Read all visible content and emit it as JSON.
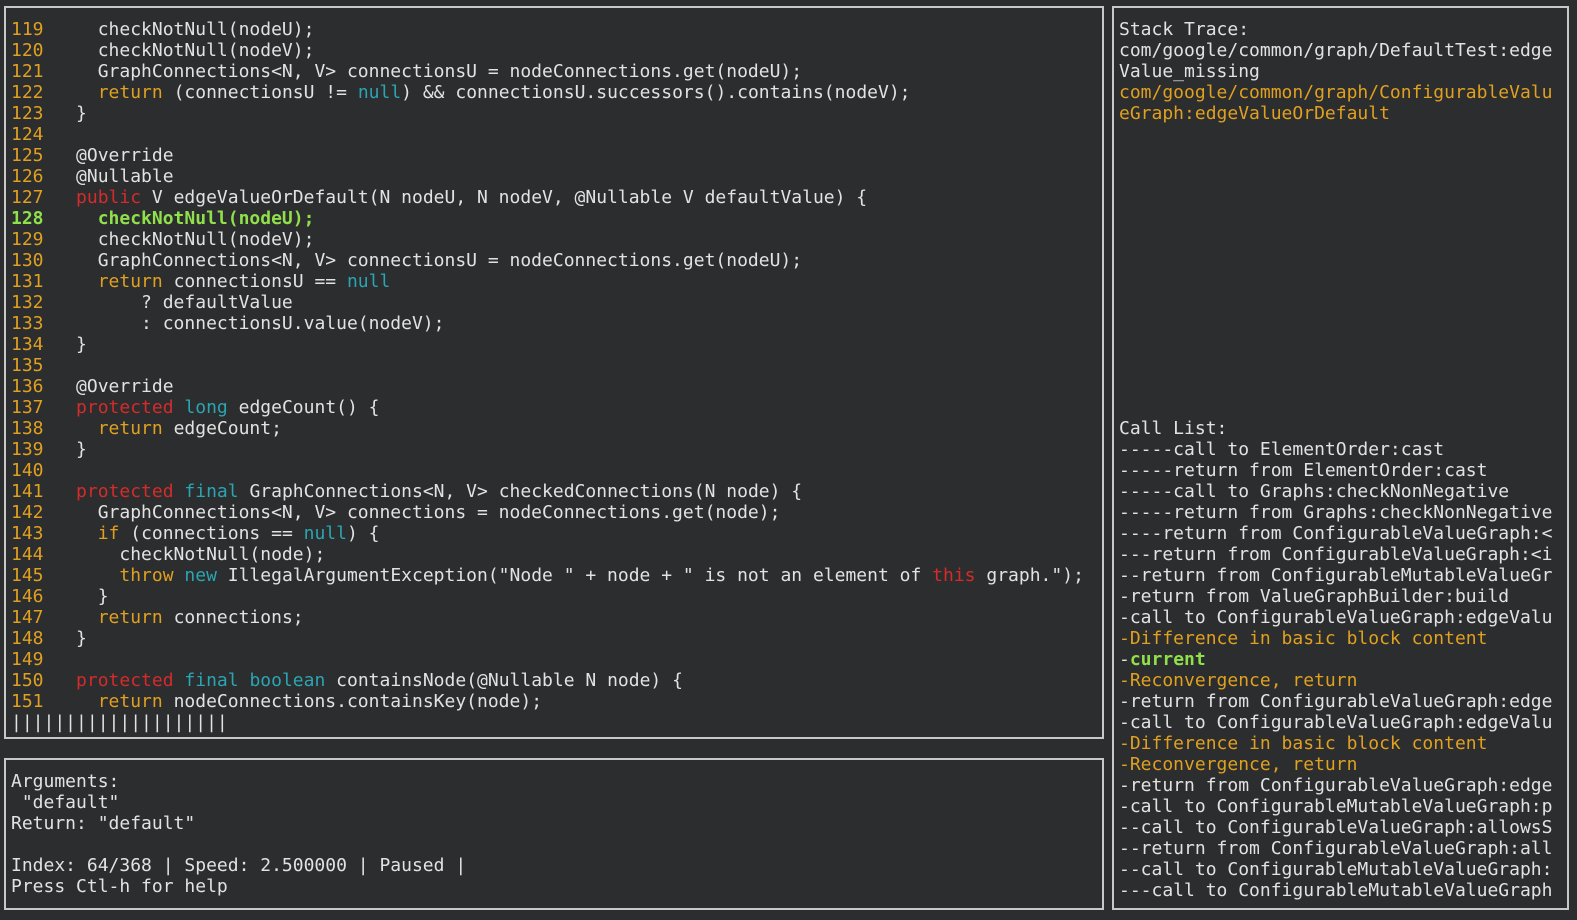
{
  "code": {
    "lines": [
      {
        "num": "119",
        "segments": [
          {
            "text": "    checkNotNull(nodeU);",
            "cls": "code-text"
          }
        ]
      },
      {
        "num": "120",
        "segments": [
          {
            "text": "    checkNotNull(nodeV);",
            "cls": "code-text"
          }
        ]
      },
      {
        "num": "121",
        "segments": [
          {
            "text": "    GraphConnections<N, V> connectionsU = nodeConnections.get(nodeU);",
            "cls": "code-text"
          }
        ]
      },
      {
        "num": "122",
        "segments": [
          {
            "text": "    ",
            "cls": "code-text"
          },
          {
            "text": "return",
            "cls": "kw-yellow"
          },
          {
            "text": " (connectionsU != ",
            "cls": "code-text"
          },
          {
            "text": "null",
            "cls": "kw-cyan"
          },
          {
            "text": ") && connectionsU.successors().contains(nodeV);",
            "cls": "code-text"
          }
        ]
      },
      {
        "num": "123",
        "segments": [
          {
            "text": "  }",
            "cls": "code-text"
          }
        ]
      },
      {
        "num": "124",
        "segments": []
      },
      {
        "num": "125",
        "segments": [
          {
            "text": "  @Override",
            "cls": "code-text"
          }
        ]
      },
      {
        "num": "126",
        "segments": [
          {
            "text": "  @Nullable",
            "cls": "code-text"
          }
        ]
      },
      {
        "num": "127",
        "segments": [
          {
            "text": "  ",
            "cls": "code-text"
          },
          {
            "text": "public",
            "cls": "kw-red"
          },
          {
            "text": " V edgeValueOrDefault(N nodeU, N nodeV, @Nullable V defaultValue) {",
            "cls": "code-text"
          }
        ]
      },
      {
        "num": "128",
        "current": true,
        "segments": [
          {
            "text": "    checkNotNull(nodeU);",
            "cls": "kw-green"
          }
        ]
      },
      {
        "num": "129",
        "segments": [
          {
            "text": "    checkNotNull(nodeV);",
            "cls": "code-text"
          }
        ]
      },
      {
        "num": "130",
        "segments": [
          {
            "text": "    GraphConnections<N, V> connectionsU = nodeConnections.get(nodeU);",
            "cls": "code-text"
          }
        ]
      },
      {
        "num": "131",
        "segments": [
          {
            "text": "    ",
            "cls": "code-text"
          },
          {
            "text": "return",
            "cls": "kw-yellow"
          },
          {
            "text": " connectionsU == ",
            "cls": "code-text"
          },
          {
            "text": "null",
            "cls": "kw-cyan"
          }
        ]
      },
      {
        "num": "132",
        "segments": [
          {
            "text": "        ? defaultValue",
            "cls": "code-text"
          }
        ]
      },
      {
        "num": "133",
        "segments": [
          {
            "text": "        : connectionsU.value(nodeV);",
            "cls": "code-text"
          }
        ]
      },
      {
        "num": "134",
        "segments": [
          {
            "text": "  }",
            "cls": "code-text"
          }
        ]
      },
      {
        "num": "135",
        "segments": []
      },
      {
        "num": "136",
        "segments": [
          {
            "text": "  @Override",
            "cls": "code-text"
          }
        ]
      },
      {
        "num": "137",
        "segments": [
          {
            "text": "  ",
            "cls": "code-text"
          },
          {
            "text": "protected",
            "cls": "kw-red"
          },
          {
            "text": " ",
            "cls": "code-text"
          },
          {
            "text": "long",
            "cls": "kw-cyan"
          },
          {
            "text": " edgeCount() {",
            "cls": "code-text"
          }
        ]
      },
      {
        "num": "138",
        "segments": [
          {
            "text": "    ",
            "cls": "code-text"
          },
          {
            "text": "return",
            "cls": "kw-yellow"
          },
          {
            "text": " edgeCount;",
            "cls": "code-text"
          }
        ]
      },
      {
        "num": "139",
        "segments": [
          {
            "text": "  }",
            "cls": "code-text"
          }
        ]
      },
      {
        "num": "140",
        "segments": []
      },
      {
        "num": "141",
        "segments": [
          {
            "text": "  ",
            "cls": "code-text"
          },
          {
            "text": "protected",
            "cls": "kw-red"
          },
          {
            "text": " ",
            "cls": "code-text"
          },
          {
            "text": "final",
            "cls": "kw-cyan"
          },
          {
            "text": " GraphConnections<N, V> checkedConnections(N node) {",
            "cls": "code-text"
          }
        ]
      },
      {
        "num": "142",
        "segments": [
          {
            "text": "    GraphConnections<N, V> connections = nodeConnections.get(node);",
            "cls": "code-text"
          }
        ]
      },
      {
        "num": "143",
        "segments": [
          {
            "text": "    ",
            "cls": "code-text"
          },
          {
            "text": "if",
            "cls": "kw-yellow"
          },
          {
            "text": " (connections == ",
            "cls": "code-text"
          },
          {
            "text": "null",
            "cls": "kw-cyan"
          },
          {
            "text": ") {",
            "cls": "code-text"
          }
        ]
      },
      {
        "num": "144",
        "segments": [
          {
            "text": "      checkNotNull(node);",
            "cls": "code-text"
          }
        ]
      },
      {
        "num": "145",
        "segments": [
          {
            "text": "      ",
            "cls": "code-text"
          },
          {
            "text": "throw",
            "cls": "kw-yellow"
          },
          {
            "text": " ",
            "cls": "code-text"
          },
          {
            "text": "new",
            "cls": "kw-cyan"
          },
          {
            "text": " IllegalArgumentException(\"Node \" + node + \" is not an element of ",
            "cls": "code-text"
          },
          {
            "text": "this",
            "cls": "kw-red"
          },
          {
            "text": " graph.\");",
            "cls": "code-text"
          }
        ]
      },
      {
        "num": "146",
        "segments": [
          {
            "text": "    }",
            "cls": "code-text"
          }
        ]
      },
      {
        "num": "147",
        "segments": [
          {
            "text": "    ",
            "cls": "code-text"
          },
          {
            "text": "return",
            "cls": "kw-yellow"
          },
          {
            "text": " connections;",
            "cls": "code-text"
          }
        ]
      },
      {
        "num": "148",
        "segments": [
          {
            "text": "  }",
            "cls": "code-text"
          }
        ]
      },
      {
        "num": "149",
        "segments": []
      },
      {
        "num": "150",
        "segments": [
          {
            "text": "  ",
            "cls": "code-text"
          },
          {
            "text": "protected",
            "cls": "kw-red"
          },
          {
            "text": " ",
            "cls": "code-text"
          },
          {
            "text": "final",
            "cls": "kw-cyan"
          },
          {
            "text": " ",
            "cls": "code-text"
          },
          {
            "text": "boolean",
            "cls": "kw-cyan"
          },
          {
            "text": " containsNode(@Nullable N node) {",
            "cls": "code-text"
          }
        ]
      },
      {
        "num": "151",
        "segments": [
          {
            "text": "    ",
            "cls": "code-text"
          },
          {
            "text": "return",
            "cls": "kw-yellow"
          },
          {
            "text": " nodeConnections.containsKey(node);",
            "cls": "code-text"
          }
        ]
      }
    ],
    "progress_bar": "||||||||||||||||||||"
  },
  "info": {
    "arguments_label": "Arguments:",
    "argument_value": " \"default\"",
    "return_line": "Return: \"default\"",
    "status_line": "Index: 64/368 | Speed: 2.500000 | Paused |",
    "help_line": "Press Ctl-h for help"
  },
  "side": {
    "stack_trace_label": "Stack Trace:",
    "stack_trace": [
      {
        "text": "com/google/common/graph/DefaultTest:edge",
        "cls": "code-text"
      },
      {
        "text": "Value_missing",
        "cls": "code-text"
      },
      {
        "text": "com/google/common/graph/ConfigurableValu",
        "cls": "kw-yellow"
      },
      {
        "text": "eGraph:edgeValueOrDefault",
        "cls": "kw-yellow"
      }
    ],
    "call_list_label": "Call List:",
    "call_list": [
      {
        "text": "-----call to ElementOrder:cast",
        "cls": "code-text"
      },
      {
        "text": "-----return from ElementOrder:cast",
        "cls": "code-text"
      },
      {
        "text": "-----call to Graphs:checkNonNegative",
        "cls": "code-text"
      },
      {
        "text": "-----return from Graphs:checkNonNegative",
        "cls": "code-text"
      },
      {
        "text": "----return from ConfigurableValueGraph:<",
        "cls": "code-text"
      },
      {
        "text": "---return from ConfigurableValueGraph:<i",
        "cls": "code-text"
      },
      {
        "text": "--return from ConfigurableMutableValueGr",
        "cls": "code-text"
      },
      {
        "text": "-return from ValueGraphBuilder:build",
        "cls": "code-text"
      },
      {
        "text": "-call to ConfigurableValueGraph:edgeValu",
        "cls": "code-text"
      },
      {
        "text": "-Difference in basic block content",
        "cls": "kw-yellow"
      },
      {
        "text": "-",
        "cls": "code-text",
        "extra": {
          "text": "current",
          "cls": "kw-green"
        }
      },
      {
        "text": "-Reconvergence, return",
        "cls": "kw-yellow"
      },
      {
        "text": "-return from ConfigurableValueGraph:edge",
        "cls": "code-text"
      },
      {
        "text": "-call to ConfigurableValueGraph:edgeValu",
        "cls": "code-text"
      },
      {
        "text": "-Difference in basic block content",
        "cls": "kw-yellow"
      },
      {
        "text": "-Reconvergence, return",
        "cls": "kw-yellow"
      },
      {
        "text": "-return from ConfigurableValueGraph:edge",
        "cls": "code-text"
      },
      {
        "text": "-call to ConfigurableMutableValueGraph:p",
        "cls": "code-text"
      },
      {
        "text": "--call to ConfigurableValueGraph:allowsS",
        "cls": "code-text"
      },
      {
        "text": "--return from ConfigurableValueGraph:all",
        "cls": "code-text"
      },
      {
        "text": "--call to ConfigurableMutableValueGraph:",
        "cls": "code-text"
      },
      {
        "text": "---call to ConfigurableMutableValueGraph",
        "cls": "code-text"
      }
    ]
  }
}
